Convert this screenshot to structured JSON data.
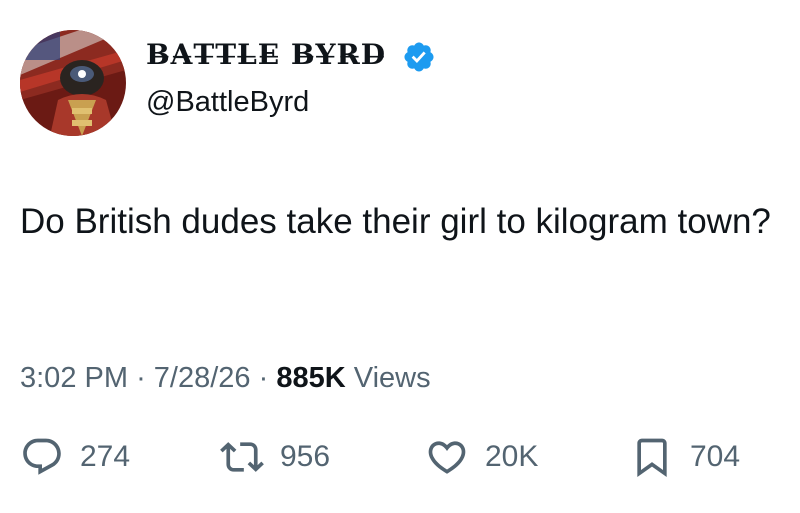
{
  "tweet": {
    "display_name": "B̶A̶T̶T̶L̶E̶ B̶Y̶R̶D̶",
    "handle": "@BattleByrd",
    "text": "Do British dudes take their girl to kilogram town?",
    "time": "3:02 PM",
    "date": "7/28/26",
    "separator": "·",
    "views_count": "885K",
    "views_label": "Views"
  },
  "actions": {
    "replies": "274",
    "reposts": "956",
    "likes": "20K",
    "bookmarks": "704"
  },
  "colors": {
    "verified": "#1d9bf0",
    "text": "#0f1419",
    "muted": "#536471"
  },
  "icons": {
    "reply": "reply-icon",
    "repost": "repost-icon",
    "like": "heart-icon",
    "bookmark": "bookmark-icon",
    "verified": "verified-badge-icon"
  }
}
